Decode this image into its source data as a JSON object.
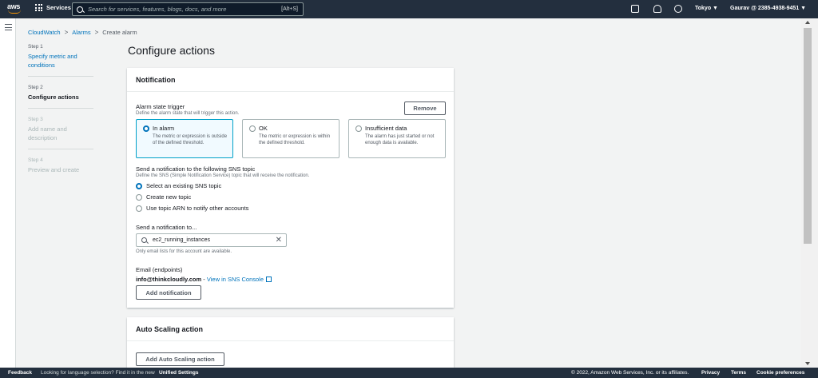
{
  "topnav": {
    "logo": "aws",
    "services": "Services",
    "search_placeholder": "Search for services, features, blogs, docs, and more",
    "search_shortcut": "[Alt+S]",
    "region": "Tokyo ▼",
    "account": "Gaurav @ 2385-4938-9451 ▼"
  },
  "breadcrumb": {
    "items": [
      "CloudWatch",
      "Alarms",
      "Create alarm"
    ]
  },
  "steps": [
    {
      "num": "Step 1",
      "name": "Specify metric and conditions"
    },
    {
      "num": "Step 2",
      "name": "Configure actions"
    },
    {
      "num": "Step 3",
      "name": "Add name and description"
    },
    {
      "num": "Step 4",
      "name": "Preview and create"
    }
  ],
  "page_title": "Configure actions",
  "notification": {
    "header": "Notification",
    "remove": "Remove",
    "trigger_label": "Alarm state trigger",
    "trigger_desc": "Define the alarm state that will trigger this action.",
    "tiles": [
      {
        "title": "In alarm",
        "desc": "The metric or expression is outside of the defined threshold.",
        "selected": true
      },
      {
        "title": "OK",
        "desc": "The metric or expression is within the defined threshold.",
        "selected": false
      },
      {
        "title": "Insufficient data",
        "desc": "The alarm has just started or not enough data is available.",
        "selected": false
      }
    ],
    "sns_label": "Send a notification to the following SNS topic",
    "sns_desc": "Define the SNS (Simple Notification Service) topic that will receive the notification.",
    "sns_options": [
      "Select an existing SNS topic",
      "Create new topic",
      "Use topic ARN to notify other accounts"
    ],
    "send_to_label": "Send a notification to...",
    "send_to_value": "ec2_running_instances",
    "send_to_hint": "Only email lists for this account are available.",
    "email_label": "Email (endpoints)",
    "email_value": "info@thinkcloudly.com",
    "email_sep": " - ",
    "view_link": "View in SNS Console",
    "add_button": "Add notification"
  },
  "auto_scaling": {
    "header": "Auto Scaling action",
    "add_button": "Add Auto Scaling action"
  },
  "footer": {
    "feedback": "Feedback",
    "lang_text": "Looking for language selection? Find it in the new",
    "lang_link": "Unified Settings",
    "copyright": "© 2022, Amazon Web Services, Inc. or its affiliates.",
    "privacy": "Privacy",
    "terms": "Terms",
    "cookies": "Cookie preferences"
  },
  "colors": {
    "nav_bg": "#232f3e",
    "link": "#0073bb",
    "accent": "#ff9900",
    "selected_border": "#00a1c9"
  }
}
